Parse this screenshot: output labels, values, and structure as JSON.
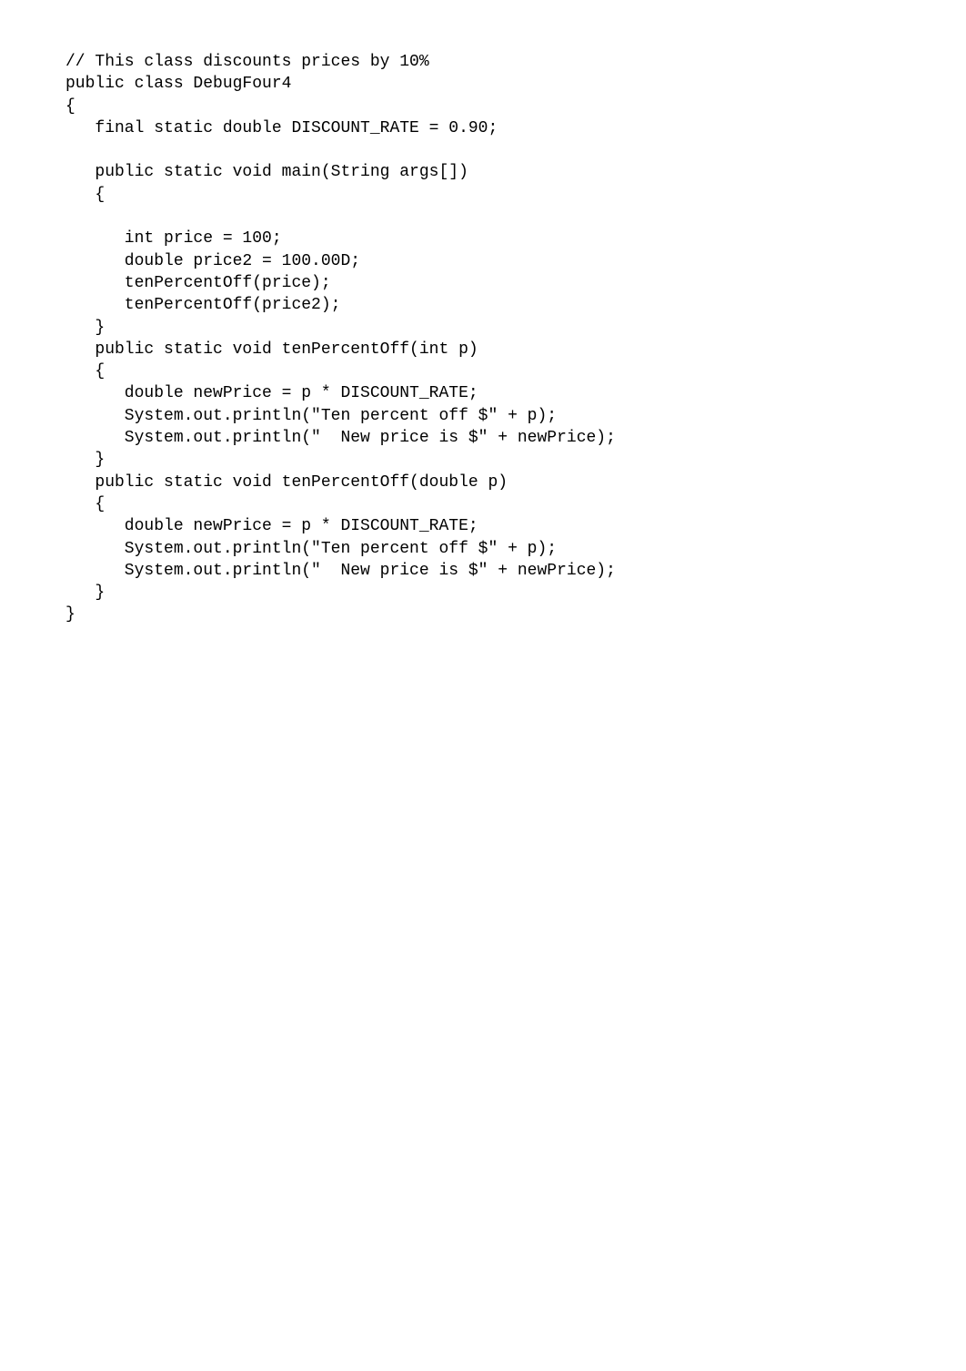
{
  "code": "// This class discounts prices by 10%\npublic class DebugFour4\n{\n   final static double DISCOUNT_RATE = 0.90;\n\n   public static void main(String args[])\n   {\n\n      int price = 100;\n      double price2 = 100.00D;\n      tenPercentOff(price);\n      tenPercentOff(price2);\n   }\n   public static void tenPercentOff(int p)\n   {\n      double newPrice = p * DISCOUNT_RATE;\n      System.out.println(\"Ten percent off $\" + p);\n      System.out.println(\"  New price is $\" + newPrice);\n   }\n   public static void tenPercentOff(double p)\n   {\n      double newPrice = p * DISCOUNT_RATE;\n      System.out.println(\"Ten percent off $\" + p);\n      System.out.println(\"  New price is $\" + newPrice);\n   }\n}"
}
